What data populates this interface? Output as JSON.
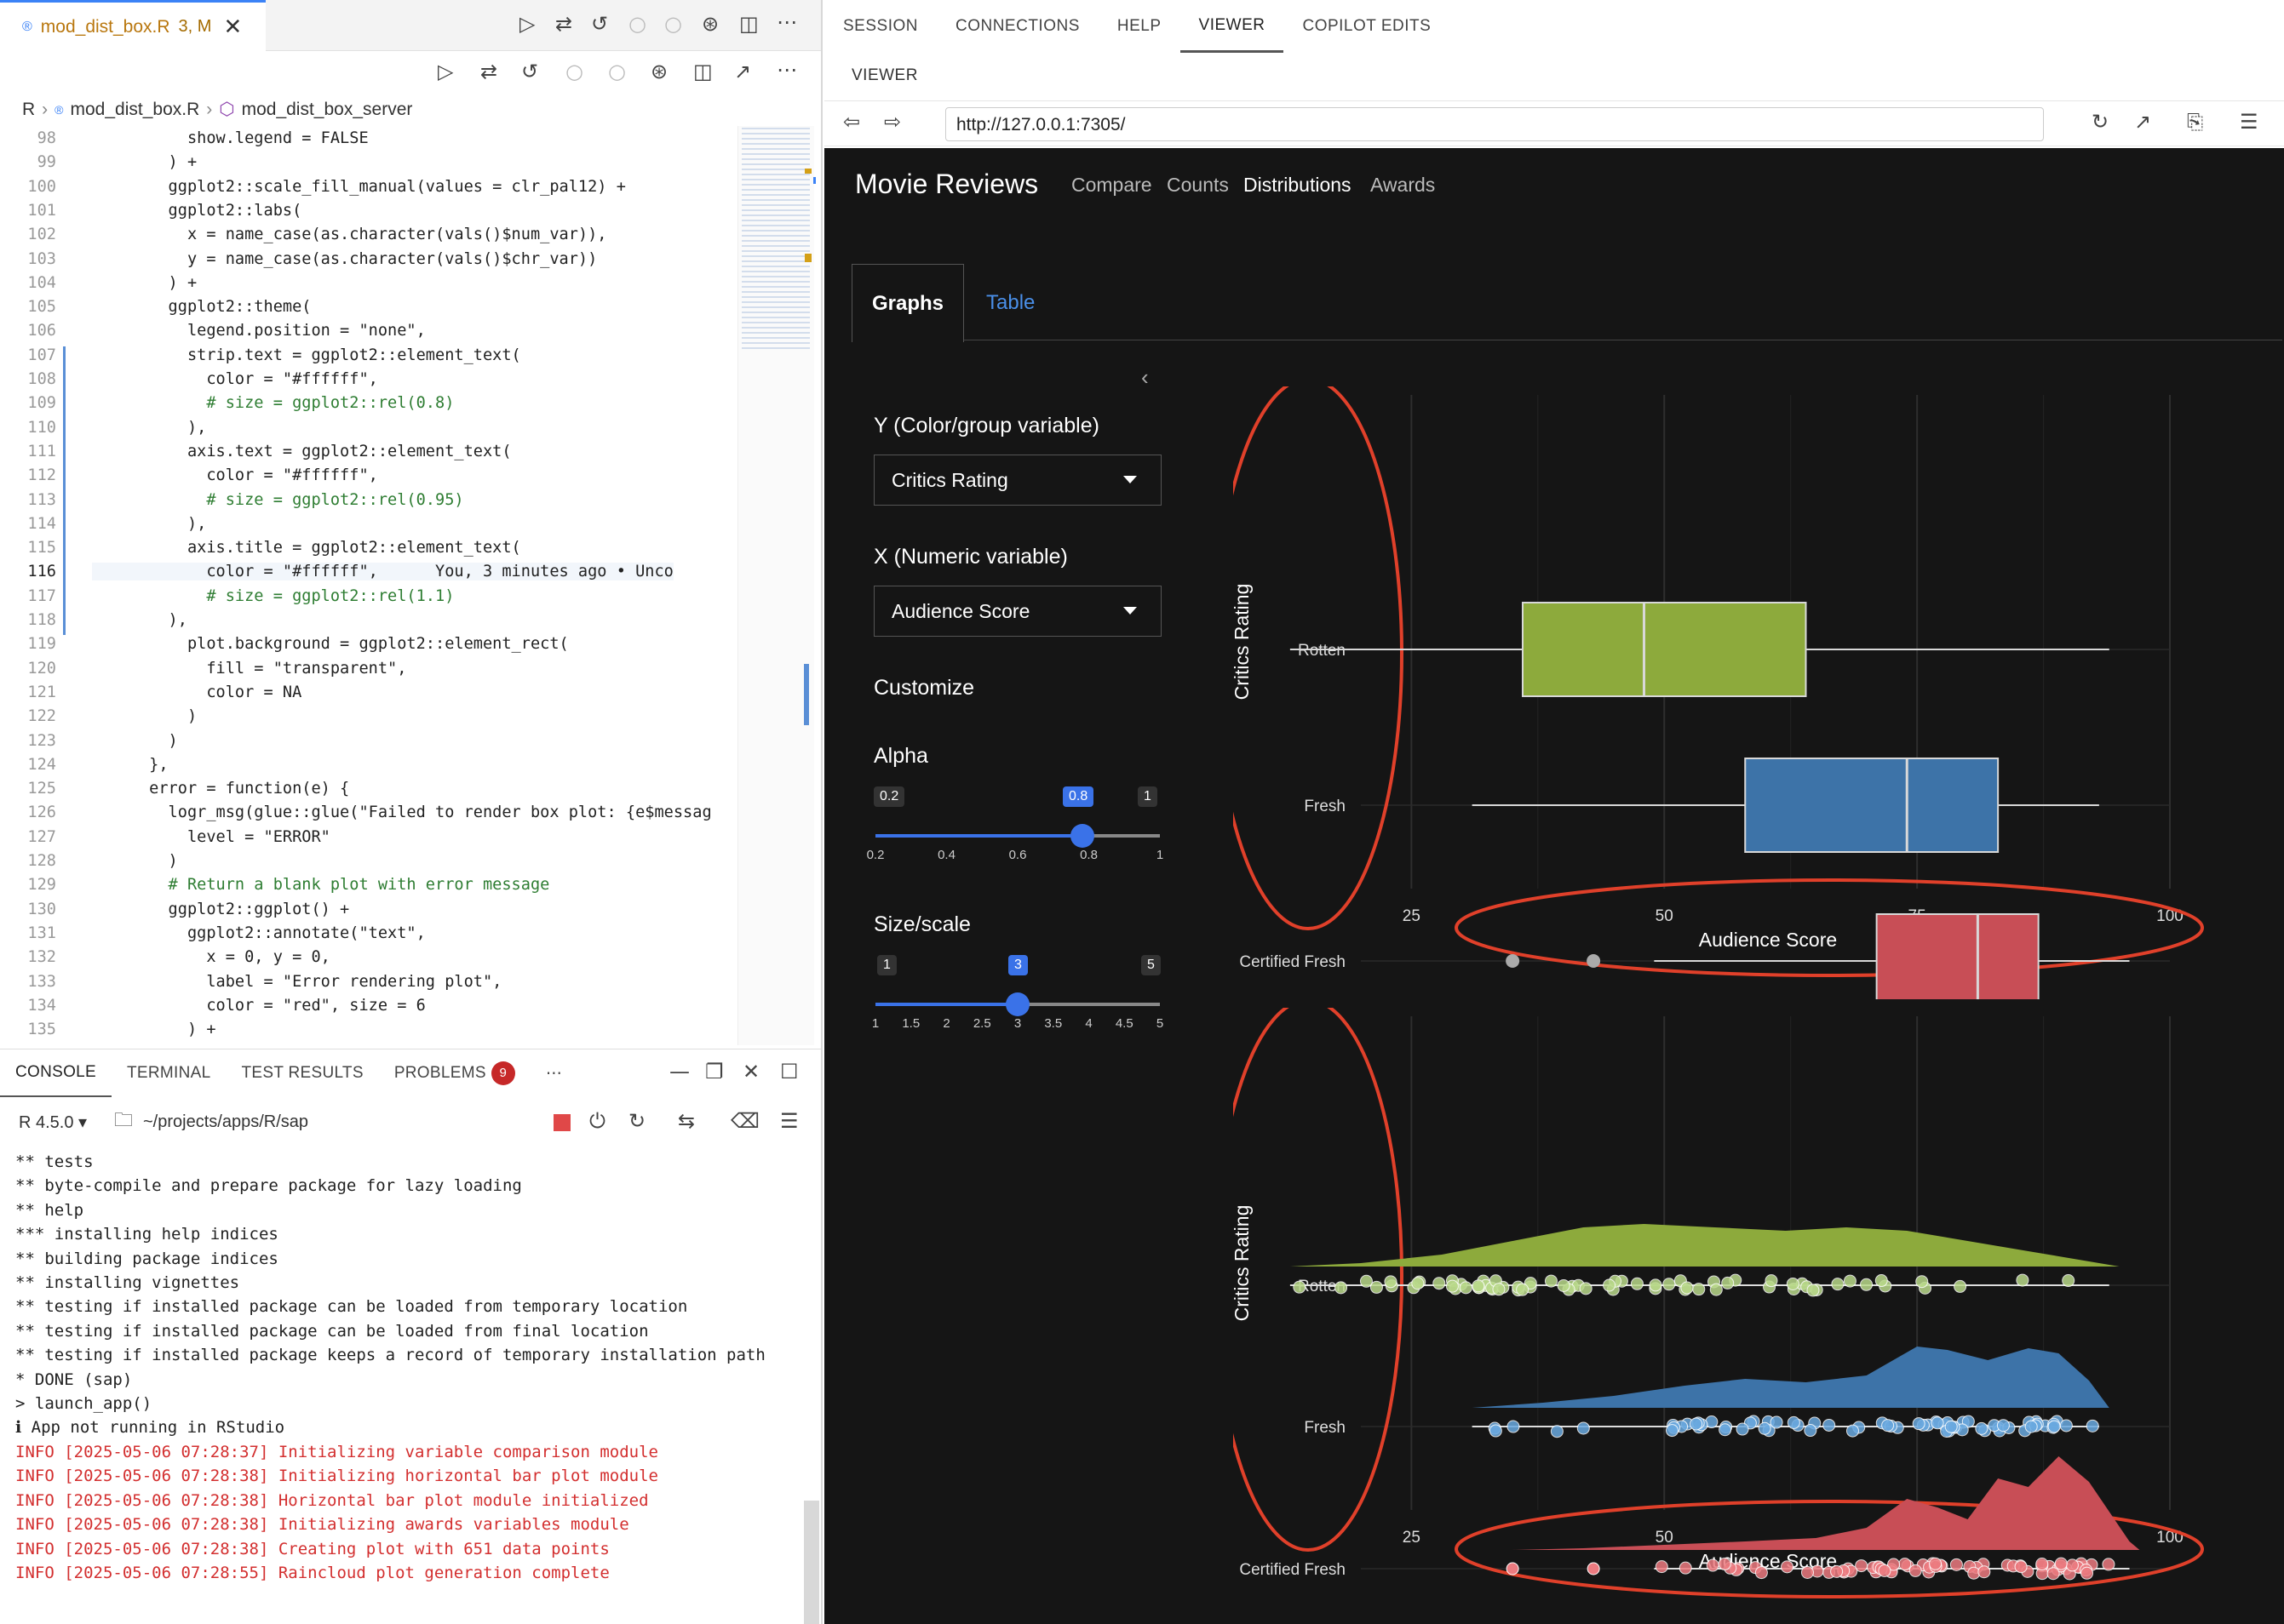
{
  "editor": {
    "tab_title": "mod_dist_box.R",
    "tab_modified": "3, M",
    "breadcrumb": [
      "R",
      "mod_dist_box.R",
      "mod_dist_box_server"
    ],
    "lines": [
      {
        "n": "98",
        "t": "          show.legend = FALSE"
      },
      {
        "n": "99",
        "t": "        ) +"
      },
      {
        "n": "100",
        "t": "        ggplot2::scale_fill_manual(values = clr_pal12) +"
      },
      {
        "n": "101",
        "t": "        ggplot2::labs("
      },
      {
        "n": "102",
        "t": "          x = name_case(as.character(vals()$num_var)),"
      },
      {
        "n": "103",
        "t": "          y = name_case(as.character(vals()$chr_var))"
      },
      {
        "n": "104",
        "t": "        ) +"
      },
      {
        "n": "105",
        "t": "        ggplot2::theme("
      },
      {
        "n": "106",
        "t": "          legend.position = \"none\","
      },
      {
        "n": "107",
        "t": "          strip.text = ggplot2::element_text("
      },
      {
        "n": "108",
        "t": "            color = \"#ffffff\","
      },
      {
        "n": "109",
        "t": "            # size = ggplot2::rel(0.8)"
      },
      {
        "n": "110",
        "t": "          ),"
      },
      {
        "n": "111",
        "t": "          axis.text = ggplot2::element_text("
      },
      {
        "n": "112",
        "t": "            color = \"#ffffff\","
      },
      {
        "n": "113",
        "t": "            # size = ggplot2::rel(0.95)"
      },
      {
        "n": "114",
        "t": "          ),"
      },
      {
        "n": "115",
        "t": "          axis.title = ggplot2::element_text("
      },
      {
        "n": "116",
        "t": "            color = \"#ffffff\",      You, 3 minutes ago • Unco"
      },
      {
        "n": "117",
        "t": "            # size = ggplot2::rel(1.1)"
      },
      {
        "n": "118",
        "t": "        ),"
      },
      {
        "n": "119",
        "t": "          plot.background = ggplot2::element_rect("
      },
      {
        "n": "120",
        "t": "            fill = \"transparent\","
      },
      {
        "n": "121",
        "t": "            color = NA"
      },
      {
        "n": "122",
        "t": "          )"
      },
      {
        "n": "123",
        "t": "        )"
      },
      {
        "n": "124",
        "t": "      },"
      },
      {
        "n": "125",
        "t": "      error = function(e) {"
      },
      {
        "n": "126",
        "t": "        logr_msg(glue::glue(\"Failed to render box plot: {e$messag"
      },
      {
        "n": "127",
        "t": "          level = \"ERROR\""
      },
      {
        "n": "128",
        "t": "        )"
      },
      {
        "n": "129",
        "t": "        # Return a blank plot with error message"
      },
      {
        "n": "130",
        "t": "        ggplot2::ggplot() +"
      },
      {
        "n": "131",
        "t": "          ggplot2::annotate(\"text\","
      },
      {
        "n": "132",
        "t": "            x = 0, y = 0,"
      },
      {
        "n": "133",
        "t": "            label = \"Error rendering plot\","
      },
      {
        "n": "134",
        "t": "            color = \"red\", size = 6"
      },
      {
        "n": "135",
        "t": "          ) +"
      }
    ]
  },
  "panel": {
    "tabs": [
      "CONSOLE",
      "TERMINAL",
      "TEST RESULTS",
      "PROBLEMS"
    ],
    "problems_count": "9",
    "r_version": "R 4.5.0",
    "path": "~/projects/apps/R/sap",
    "console_lines": [
      {
        "t": "** tests",
        "c": "n"
      },
      {
        "t": "** byte-compile and prepare package for lazy loading",
        "c": "n"
      },
      {
        "t": "** help",
        "c": "n"
      },
      {
        "t": "*** installing help indices",
        "c": "n"
      },
      {
        "t": "** building package indices",
        "c": "n"
      },
      {
        "t": "** installing vignettes",
        "c": "n"
      },
      {
        "t": "** testing if installed package can be loaded from temporary location",
        "c": "n"
      },
      {
        "t": "** testing if installed package can be loaded from final location",
        "c": "n"
      },
      {
        "t": "** testing if installed package keeps a record of temporary installation path",
        "c": "n"
      },
      {
        "t": "* DONE (sap)",
        "c": "n"
      },
      {
        "t": "> launch_app()",
        "c": "n"
      },
      {
        "t": "ℹ App not running in RStudio",
        "c": "n"
      },
      {
        "t": "INFO [2025-05-06 07:28:37] Initializing variable comparison module",
        "c": "i"
      },
      {
        "t": "INFO [2025-05-06 07:28:38] Initializing horizontal bar plot module",
        "c": "i"
      },
      {
        "t": "INFO [2025-05-06 07:28:38] Horizontal bar plot module initialized",
        "c": "i"
      },
      {
        "t": "INFO [2025-05-06 07:28:38] Initializing awards variables module",
        "c": "i"
      },
      {
        "t": "INFO [2025-05-06 07:28:38] Creating plot with 651 data points",
        "c": "i"
      },
      {
        "t": "INFO [2025-05-06 07:28:55] Raincloud plot generation complete",
        "c": "i"
      }
    ]
  },
  "right": {
    "tabs": [
      "SESSION",
      "CONNECTIONS",
      "HELP",
      "VIEWER",
      "COPILOT EDITS"
    ],
    "viewer_label": "VIEWER",
    "url": "http://127.0.0.1:7305/"
  },
  "app": {
    "brand": "Movie Reviews",
    "nav": [
      "Compare",
      "Counts",
      "Distributions",
      "Awards"
    ],
    "tabs": {
      "graphs": "Graphs",
      "table": "Table"
    },
    "y_label": "Y (Color/group variable)",
    "y_value": "Critics Rating",
    "x_label": "X (Numeric variable)",
    "x_value": "Audience Score",
    "customize": "Customize",
    "alpha": {
      "label": "Alpha",
      "min": "0.2",
      "max": "1",
      "value": "0.8",
      "ticks": [
        "0.2",
        "0.4",
        "0.6",
        "0.8",
        "1"
      ]
    },
    "size": {
      "label": "Size/scale",
      "min": "1",
      "max": "5",
      "value": "3",
      "ticks": [
        "1",
        "1.5",
        "2",
        "2.5",
        "3",
        "3.5",
        "4",
        "4.5",
        "5"
      ]
    }
  },
  "chart_data": [
    {
      "type": "box",
      "ylabel": "Critics Rating",
      "xlabel": "Audience Score",
      "xticks": [
        "25",
        "50",
        "75",
        "100"
      ],
      "xlim": [
        20,
        100
      ],
      "categories": [
        "Rotten",
        "Fresh",
        "Certified Fresh"
      ],
      "boxes": [
        {
          "name": "Rotten",
          "min": 13,
          "q1": 36,
          "median": 48,
          "q3": 64,
          "max": 94,
          "color": "#8daa3c",
          "outliers": []
        },
        {
          "name": "Fresh",
          "min": 31,
          "q1": 58,
          "median": 74,
          "q3": 83,
          "max": 93,
          "color": "#3d73a8",
          "outliers": []
        },
        {
          "name": "Certified Fresh",
          "min": 49,
          "q1": 71,
          "median": 81,
          "q3": 87,
          "max": 96,
          "color": "#c84e56",
          "outliers": [
            35,
            43
          ]
        }
      ]
    },
    {
      "type": "raincloud",
      "ylabel": "Critics Rating",
      "xlabel": "Audience Score",
      "xticks": [
        "25",
        "50",
        "75",
        "100"
      ],
      "xlim": [
        20,
        100
      ],
      "categories": [
        "Rotten",
        "Fresh",
        "Certified Fresh"
      ],
      "colors": {
        "Rotten": "#8daa3c",
        "Fresh": "#3d73a8",
        "Certified Fresh": "#c84e56"
      },
      "point_colors": {
        "Rotten": "#b9d98a",
        "Fresh": "#6aa9e0",
        "Certified Fresh": "#ec7b80"
      }
    }
  ]
}
